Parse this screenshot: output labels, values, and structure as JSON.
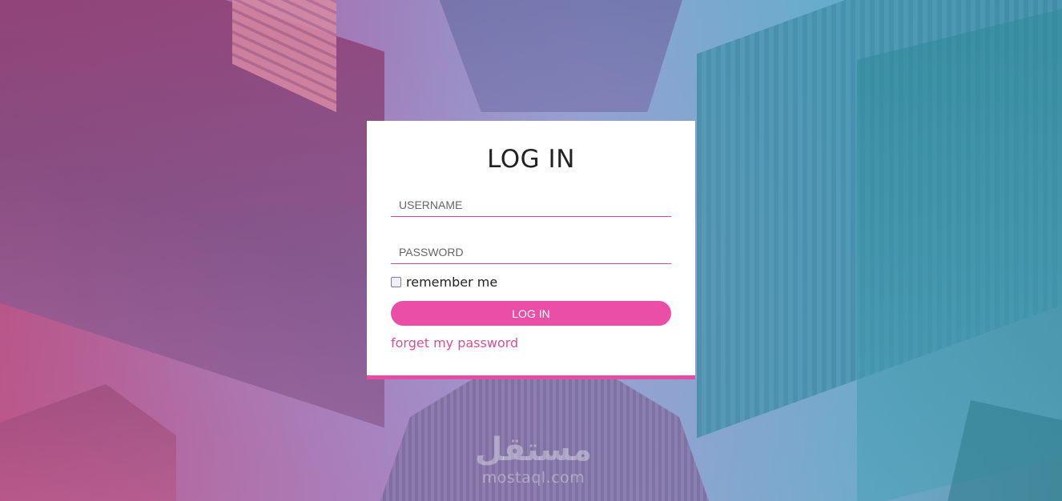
{
  "login": {
    "title": "LOG IN",
    "username_placeholder": "USERNAME",
    "username_value": "",
    "password_placeholder": "PASSWORD",
    "password_value": "",
    "remember_label": "remember me",
    "remember_checked": false,
    "submit_label": "LOG IN",
    "forgot_label": "forget my password"
  },
  "watermark": {
    "arabic": "مستقل",
    "latin": "mostaql.com"
  },
  "colors": {
    "accent": "#ea4ea6",
    "card_border": "#e84ca4",
    "link": "#d64f98"
  }
}
